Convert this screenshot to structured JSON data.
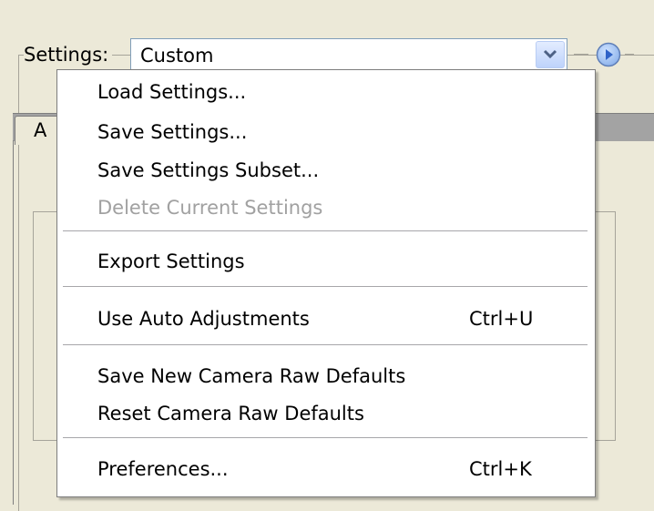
{
  "settings": {
    "label": "Settings:",
    "selected_value": "Custom"
  },
  "tabs": {
    "first_tab_label": "A"
  },
  "menu": {
    "items": [
      {
        "label": "Load Settings...",
        "shortcut": "",
        "enabled": true
      },
      {
        "label": "Save Settings...",
        "shortcut": "",
        "enabled": true
      },
      {
        "label": "Save Settings Subset...",
        "shortcut": "",
        "enabled": true
      },
      {
        "label": "Delete Current Settings",
        "shortcut": "",
        "enabled": false
      },
      {
        "label": "Export Settings",
        "shortcut": "",
        "enabled": true
      },
      {
        "label": "Use Auto Adjustments",
        "shortcut": "Ctrl+U",
        "enabled": true
      },
      {
        "label": "Save New Camera Raw Defaults",
        "shortcut": "",
        "enabled": true
      },
      {
        "label": "Reset Camera Raw Defaults",
        "shortcut": "",
        "enabled": true
      },
      {
        "label": "Preferences...",
        "shortcut": "Ctrl+K",
        "enabled": true
      }
    ]
  },
  "colors": {
    "dialog_background": "#ece9d8",
    "disabled_text": "#a1a1a1",
    "options_button_blue": "#3b7be0"
  },
  "icons": {
    "select_arrow": "chevron-down-icon",
    "options_button": "play-circle-icon"
  }
}
